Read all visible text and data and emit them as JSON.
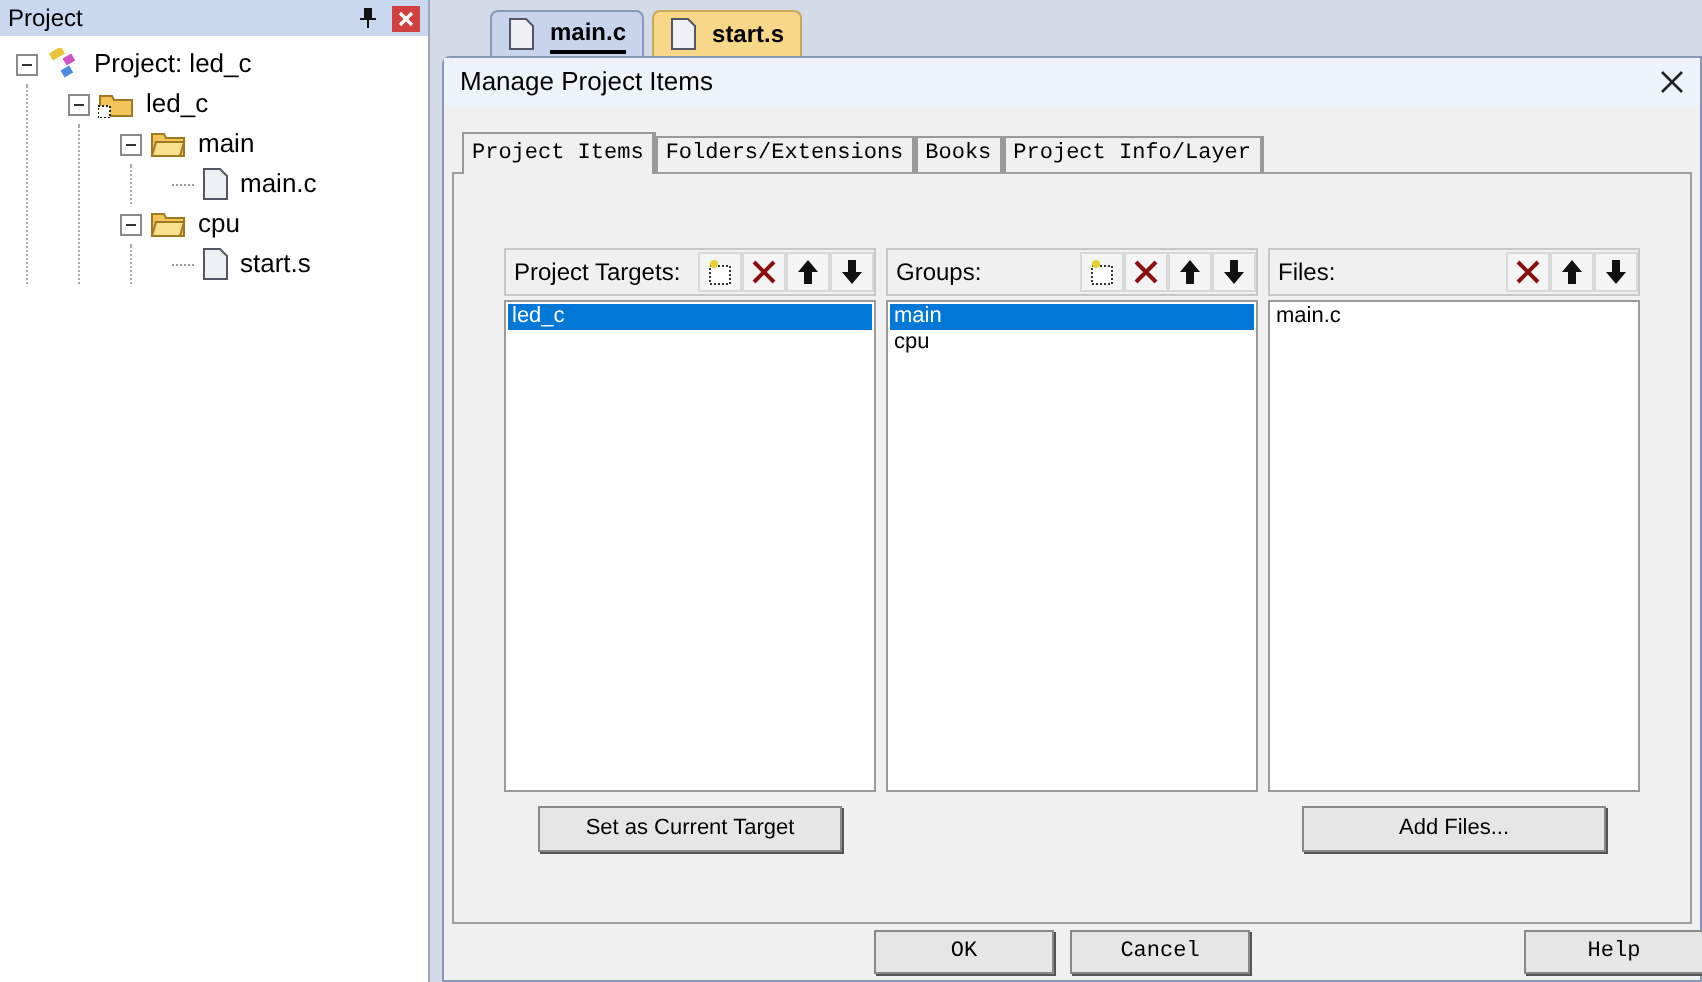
{
  "project_panel": {
    "title": "Project",
    "tree": [
      {
        "label": "Project: led_c",
        "kind": "project",
        "expanded": true,
        "children": [
          {
            "label": "led_c",
            "kind": "target",
            "expanded": true,
            "children": [
              {
                "label": "main",
                "kind": "group",
                "expanded": true,
                "children": [
                  {
                    "label": "main.c",
                    "kind": "file"
                  }
                ]
              },
              {
                "label": "cpu",
                "kind": "group",
                "expanded": true,
                "children": [
                  {
                    "label": "start.s",
                    "kind": "file"
                  }
                ]
              }
            ]
          }
        ]
      }
    ]
  },
  "editor_tabs": [
    {
      "label": "main.c",
      "selected": true
    },
    {
      "label": "start.s",
      "selected": false
    }
  ],
  "dialog": {
    "title": "Manage Project Items",
    "tabs": [
      {
        "label": "Project Items",
        "selected": true
      },
      {
        "label": "Folders/Extensions",
        "selected": false
      },
      {
        "label": "Books",
        "selected": false
      },
      {
        "label": "Project Info/Layer",
        "selected": false
      }
    ],
    "lists": [
      {
        "title": "Project Targets:",
        "tools": [
          {
            "kind": "new"
          },
          {
            "kind": "delete"
          },
          {
            "kind": "up"
          },
          {
            "kind": "down"
          }
        ],
        "items": [
          {
            "label": "led_c",
            "selected": true
          }
        ],
        "action": "Set as Current Target"
      },
      {
        "title": "Groups:",
        "tools": [
          {
            "kind": "new"
          },
          {
            "kind": "delete"
          },
          {
            "kind": "up"
          },
          {
            "kind": "down"
          }
        ],
        "items": [
          {
            "label": "main",
            "selected": true
          },
          {
            "label": "cpu",
            "selected": false
          }
        ]
      },
      {
        "title": "Files:",
        "tools": [
          {
            "kind": "delete"
          },
          {
            "kind": "up"
          },
          {
            "kind": "down"
          }
        ],
        "items": [
          {
            "label": "main.c",
            "selected": false
          }
        ],
        "action": "Add Files..."
      }
    ],
    "buttons": [
      "OK",
      "Cancel",
      "Help"
    ]
  }
}
